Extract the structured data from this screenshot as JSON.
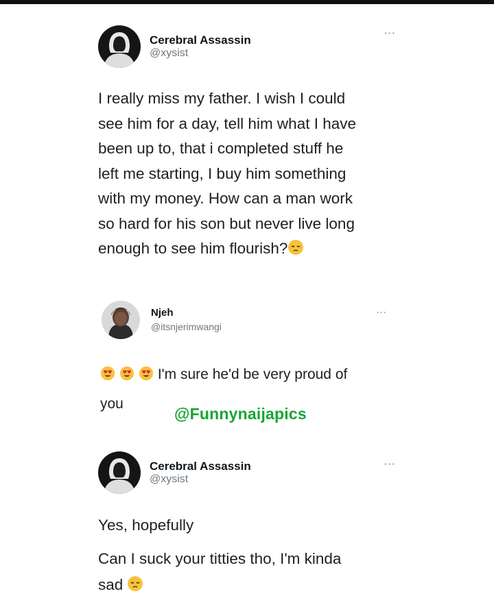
{
  "tweets": [
    {
      "author": "Cerebral Assassin",
      "handle": "@xysist",
      "more_label": "···",
      "text": "I really miss my father. I wish I could\nsee him for a day, tell him what I have\nbeen up to, that i completed stuff he\nleft me starting, I buy him something\nwith my money. How can a man work\nso hard for his son but never live long\nenough to see him flourish?",
      "trailing_emoji": "pensive-face"
    },
    {
      "author": "Njeh",
      "handle": "@itsnjerimwangi",
      "more_label": "···",
      "leading_emojis": [
        "heart-eyes-face",
        "heart-eyes-face",
        "heart-eyes-face"
      ],
      "text": " I'm sure he'd be very proud of\nyou"
    },
    {
      "author": "Cerebral Assassin",
      "handle": "@xysist",
      "more_label": "···",
      "text_line1": "Yes, hopefully",
      "text_line2": "Can I suck your titties tho, I'm kinda\nsad",
      "trailing_emoji": "pensive-face"
    }
  ],
  "watermark": "@Funnynaijapics",
  "colors": {
    "watermark": "#17a534",
    "handle": "#6e767d",
    "text": "#1f1f1f",
    "emoji": "#f7c23c"
  }
}
